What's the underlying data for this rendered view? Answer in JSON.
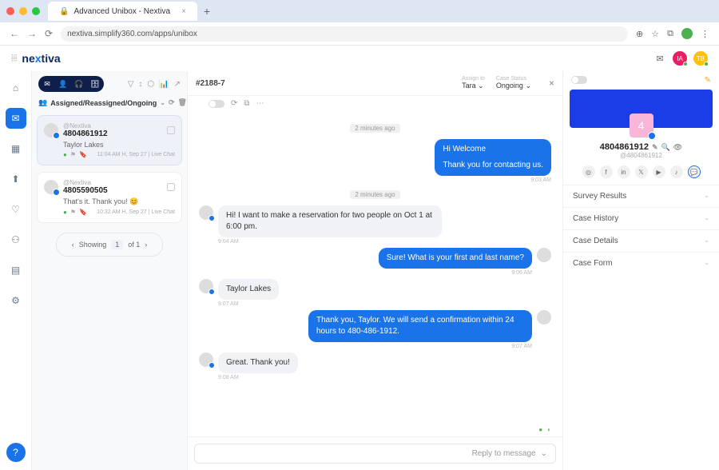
{
  "browser": {
    "tab_title": "Advanced Unibox - Nextiva",
    "url": "nextiva.simplify360.com/apps/unibox"
  },
  "header": {
    "logo_text": "nextiva",
    "avatar1": "IA",
    "avatar2": "TB"
  },
  "inbox": {
    "filter_label": "Assigned/Reassigned/Ongoing",
    "conversations": [
      {
        "brand": "@Nextiva",
        "title": "4804861912",
        "subtitle": "Taylor Lakes",
        "timestamp": "11:04 AM H, Sep 27 | Live Chat"
      },
      {
        "brand": "@Nextiva",
        "title": "4805590505",
        "subtitle": "That's it. Thank you! 😊",
        "timestamp": "10:32 AM H, Sep 27 | Live Chat"
      }
    ],
    "pager_label": "Showing",
    "pager_current": "1",
    "pager_total": "of 1"
  },
  "chat": {
    "case_id": "#2188-7",
    "assign_label": "Assign to",
    "assign_value": "Tara",
    "status_label": "Case Status",
    "status_value": "Ongoing",
    "sep1": "2 minutes ago",
    "sep2": "2 minutes ago",
    "messages": {
      "m1a": "Hi Welcome",
      "m1b": "Thank you for contacting us.",
      "m1_ts": "9:03 AM",
      "m2": "Hi! I want to make a reservation for two people on Oct 1 at 6:00 pm.",
      "m2_ts": "9:04 AM",
      "m3": "Sure! What is your first and last name?",
      "m3_ts": "9:06 AM",
      "m4": "Taylor Lakes",
      "m4_ts": "9:07 AM",
      "m5": "Thank you, Taylor. We will send a confirmation within 24 hours to 480-486-1912.",
      "m5_ts": "9:07 AM",
      "m6": "Great. Thank you!",
      "m6_ts": "9:08 AM"
    },
    "reply_placeholder": "Reply to message"
  },
  "profile": {
    "avatar_char": "4",
    "name": "4804861912",
    "handle": "@4804861912",
    "accordions": [
      "Survey Results",
      "Case History",
      "Case Details",
      "Case Form"
    ]
  }
}
